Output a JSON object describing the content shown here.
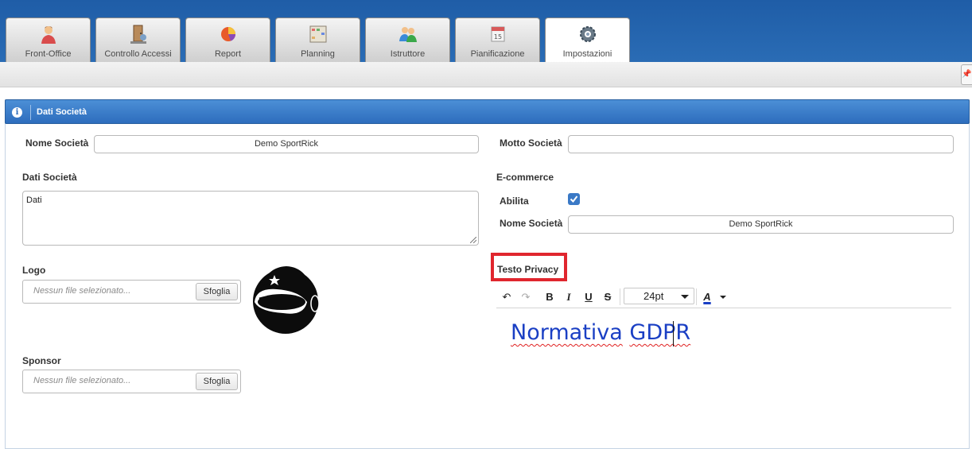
{
  "tabs": [
    {
      "label": "Front-Office",
      "icon": "receptionist-icon",
      "active": false
    },
    {
      "label": "Controllo Accessi",
      "icon": "access-door-icon",
      "active": false
    },
    {
      "label": "Report",
      "icon": "pie-chart-icon",
      "active": false
    },
    {
      "label": "Planning",
      "icon": "planning-grid-icon",
      "active": false
    },
    {
      "label": "Istruttore",
      "icon": "instructors-icon",
      "active": false
    },
    {
      "label": "Pianificazione",
      "icon": "calendar-icon",
      "active": false
    },
    {
      "label": "Impostazioni",
      "icon": "gear-icon",
      "active": true
    }
  ],
  "panel": {
    "title": "Dati Società"
  },
  "form": {
    "nome_societa_label": "Nome Società",
    "nome_societa_value": "Demo SportRick",
    "motto_label": "Motto Società",
    "motto_value": "",
    "dati_label": "Dati Società",
    "dati_value": "Dati",
    "ecommerce_label": "E-commerce",
    "abilita_label": "Abilita",
    "abilita_checked": true,
    "ecom_nome_label": "Nome Società",
    "ecom_nome_value": "Demo SportRick",
    "logo_label": "Logo",
    "logo_placeholder": "Nessun file selezionato...",
    "logo_browse": "Sfoglia",
    "sponsor_label": "Sponsor",
    "sponsor_placeholder": "Nessun file selezionato...",
    "sponsor_browse": "Sfoglia",
    "privacy_label": "Testo Privacy"
  },
  "editor": {
    "undo": "↶",
    "redo": "↷",
    "bold": "B",
    "italic": "I",
    "underline": "U",
    "strike": "S",
    "font_size": "24pt",
    "color_letter": "A",
    "text_word1": "Normativa",
    "text_word2": "GDPR",
    "text_color": "#1a3fc4",
    "highlight_color": "#e0262e"
  }
}
